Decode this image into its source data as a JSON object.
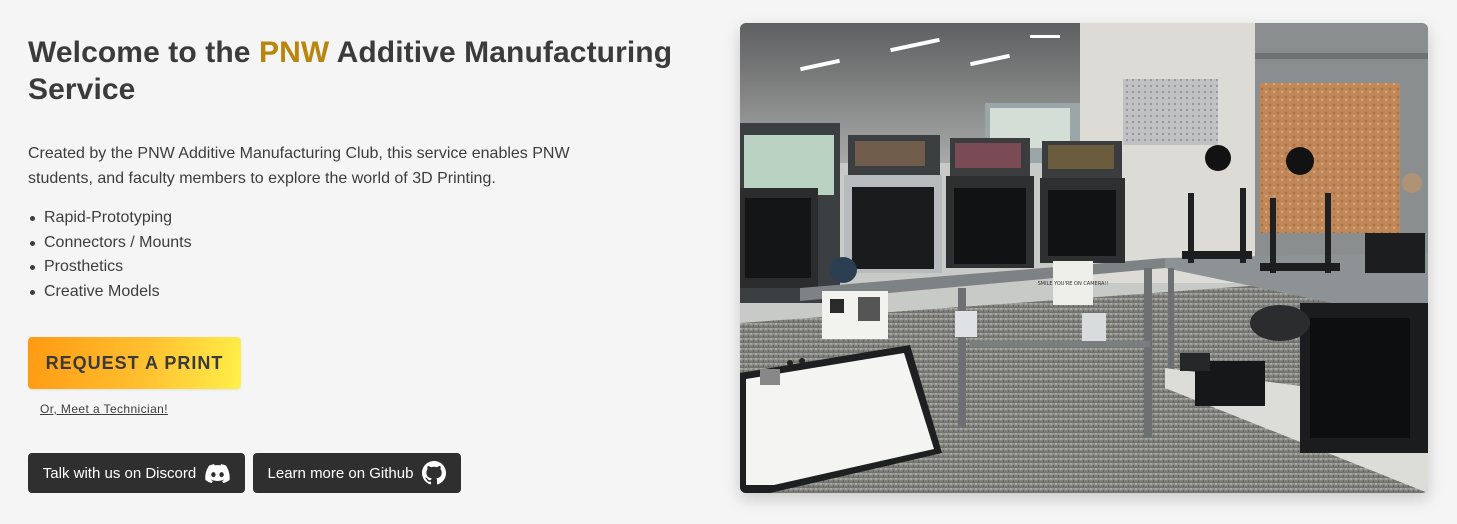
{
  "hero": {
    "title_prefix": "Welcome to the ",
    "title_highlight": "PNW",
    "title_suffix": " Additive Manufacturing Service",
    "description": "Created by the PNW Additive Manufacturing Club, this service enables PNW students, and faculty members to explore the world of 3D Printing.",
    "features": [
      "Rapid-Prototyping",
      "Connectors / Mounts",
      "Prosthetics",
      "Creative Models"
    ],
    "request_button": "REQUEST A PRINT",
    "technician_link": "Or, Meet a Technician!",
    "discord_button": "Talk with us on Discord",
    "github_button": "Learn more on Github"
  },
  "colors": {
    "highlight": "#b8860b",
    "dark_button": "#2f2f2f",
    "cta_gradient_start": "#ff9a12",
    "cta_gradient_end": "#fff04a",
    "background": "#f5f5f5"
  },
  "icons": {
    "discord": "discord-icon",
    "github": "github-icon"
  },
  "photo": {
    "sign_label": "SMILE YOU'RE ON CAMERA!!"
  }
}
